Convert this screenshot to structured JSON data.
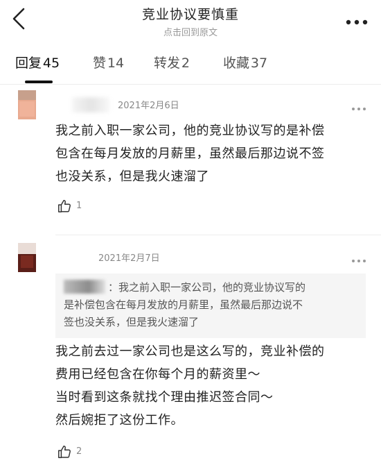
{
  "header": {
    "title": "竞业协议要慎重",
    "subtitle": "点击回到原文"
  },
  "tabs": [
    {
      "label": "回复",
      "count": "45"
    },
    {
      "label": "赞",
      "count": "14"
    },
    {
      "label": "转发",
      "count": "2"
    },
    {
      "label": "收藏",
      "count": "37"
    }
  ],
  "comments": [
    {
      "date": "2021年2月6日",
      "lines": [
        "我之前入职一家公司，他的竞业协议写的是补偿",
        "包含在每月发放的月薪里，虽然最后那边说不签",
        "也没关系，但是我火速溜了"
      ],
      "likes": "1"
    },
    {
      "date": "2021年2月7日",
      "quote_lines": [
        "：我之前入职一家公司，他的竞业协议写的",
        "是补偿包含在每月发放的月薪里，虽然最后那边说不",
        "签也没关系，但是我火速溜了"
      ],
      "lines": [
        "我之前去过一家公司也是这么写的，竞业补偿的",
        "费用已经包含在你每个月的薪资里～",
        "当时看到这条就找个理由推迟签合同～",
        "然后婉拒了这份工作。"
      ],
      "likes": "2"
    }
  ],
  "icons": {
    "back": "chevron-left-icon",
    "more": "more-horizontal-icon",
    "like": "thumbs-up-icon"
  },
  "colors": {
    "text": "#222222",
    "muted": "#888888",
    "quote_bg": "#f5f5f5",
    "divider": "#ededed"
  }
}
